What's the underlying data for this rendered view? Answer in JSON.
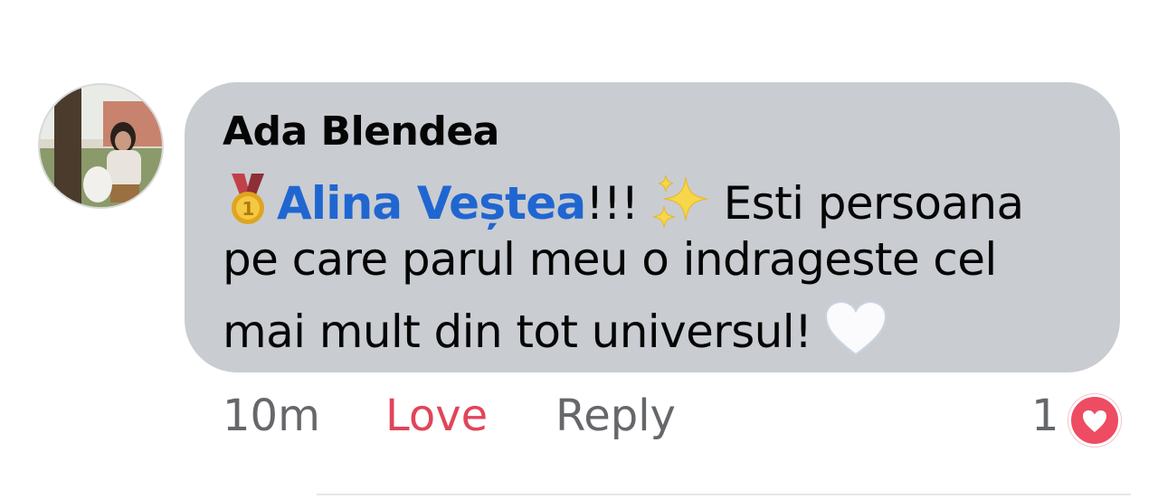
{
  "comment": {
    "author": "Ada Blendea",
    "mention": "Alina Veștea",
    "line1_after_mention": "!!!",
    "line1_after_sparkles": "Esti persoana",
    "line2": "pe care parul meu o indrageste cel",
    "line3": "mai mult din tot universul!",
    "icons": [
      "medal-icon",
      "sparkles-icon",
      "white-heart-icon"
    ]
  },
  "actions": {
    "time": "10m",
    "love_label": "Love",
    "reply_label": "Reply"
  },
  "reactions": {
    "count": "1",
    "type": "love-heart-icon"
  },
  "colors": {
    "bubble": "#c9ccd1",
    "mention": "#2066d1",
    "love": "#e0455a",
    "meta_text": "#65676b",
    "reaction_badge": "#ee4c63"
  }
}
